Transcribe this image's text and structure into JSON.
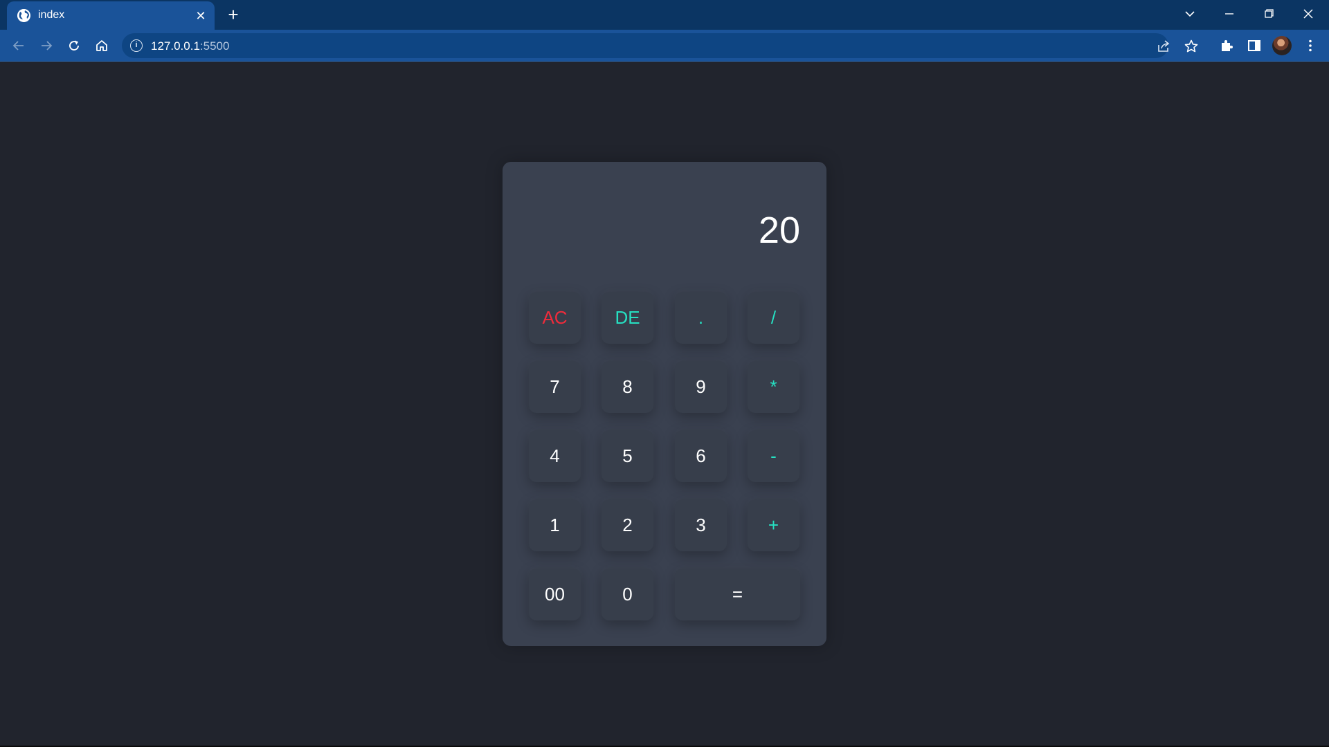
{
  "browser": {
    "tab": {
      "title": "index",
      "close_glyph": "✕",
      "favicon": "globe-icon"
    },
    "new_tab_glyph": "+",
    "window_controls": {
      "list_glyph": "⌄",
      "minimize_glyph": "—",
      "restore_glyph": "❐",
      "close_glyph": "✕"
    },
    "address": {
      "host": "127.0.0.1",
      "port": ":5500"
    },
    "toolbar_icons": [
      "back-arrow-icon",
      "forward-arrow-icon",
      "reload-icon",
      "home-icon",
      "site-info-icon",
      "share-icon",
      "bookmark-star-icon",
      "extensions-puzzle-icon",
      "side-panel-icon",
      "profile-avatar",
      "kebab-menu-icon"
    ],
    "colors": {
      "tabstrip": "#0b3563",
      "toolbar": "#1a5399",
      "omnibox": "#0e4583"
    }
  },
  "calculator": {
    "display_value": "20",
    "keys": [
      {
        "label": "AC",
        "kind": "clear"
      },
      {
        "label": "DE",
        "kind": "op"
      },
      {
        "label": ".",
        "kind": "op"
      },
      {
        "label": "/",
        "kind": "op"
      },
      {
        "label": "7",
        "kind": "digit"
      },
      {
        "label": "8",
        "kind": "digit"
      },
      {
        "label": "9",
        "kind": "digit"
      },
      {
        "label": "*",
        "kind": "op"
      },
      {
        "label": "4",
        "kind": "digit"
      },
      {
        "label": "5",
        "kind": "digit"
      },
      {
        "label": "6",
        "kind": "digit"
      },
      {
        "label": "-",
        "kind": "op"
      },
      {
        "label": "1",
        "kind": "digit"
      },
      {
        "label": "2",
        "kind": "digit"
      },
      {
        "label": "3",
        "kind": "digit"
      },
      {
        "label": "+",
        "kind": "op"
      },
      {
        "label": "00",
        "kind": "digit"
      },
      {
        "label": "0",
        "kind": "digit"
      },
      {
        "label": "=",
        "kind": "equals"
      }
    ],
    "colors": {
      "page_bg": "#21242d",
      "panel": "#3a4150",
      "key": "#373e4b",
      "operator": "#26e0c2",
      "clear": "#f02b3b",
      "text": "#ffffff"
    }
  }
}
